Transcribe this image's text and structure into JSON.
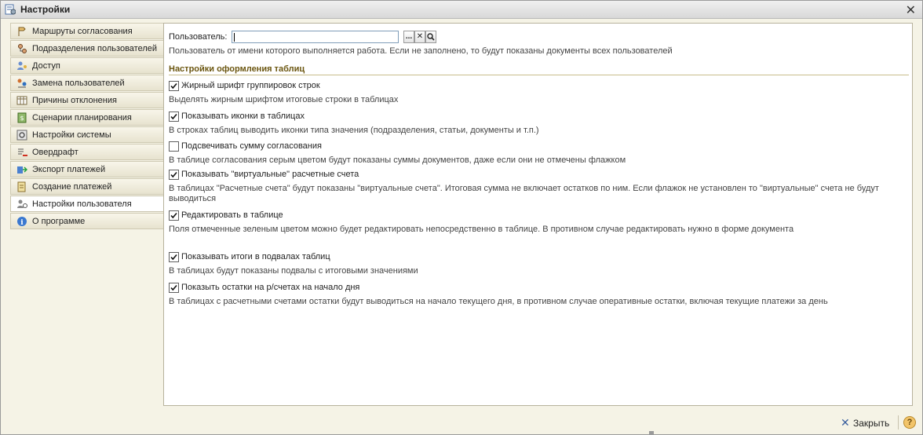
{
  "window": {
    "title": "Настройки",
    "close_glyph": "✕"
  },
  "sidebar": {
    "items": [
      {
        "label": "Маршруты согласования",
        "icon": "route-icon"
      },
      {
        "label": "Подразделения пользователей",
        "icon": "org-tree-icon"
      },
      {
        "label": "Доступ",
        "icon": "users-key-icon"
      },
      {
        "label": "Замена пользователей",
        "icon": "swap-users-icon"
      },
      {
        "label": "Причины отклонения",
        "icon": "table-icon"
      },
      {
        "label": "Сценарии планирования",
        "icon": "scenario-icon"
      },
      {
        "label": "Настройки системы",
        "icon": "settings-icon"
      },
      {
        "label": "Овердрафт",
        "icon": "overdraft-icon"
      },
      {
        "label": "Экспорт платежей",
        "icon": "export-icon"
      },
      {
        "label": "Создание платежей",
        "icon": "create-doc-icon"
      },
      {
        "label": "Настройки пользователя",
        "icon": "user-settings-icon"
      },
      {
        "label": "О программе",
        "icon": "info-icon"
      }
    ],
    "active_index": 10
  },
  "user": {
    "label": "Пользователь:",
    "value": "",
    "select_button": "...",
    "clear_button": "✕",
    "hint": "Пользователь от имени которого выполняется работа. Если не заполнено, то будут показаны документы всех пользователей"
  },
  "section": {
    "title": "Настройки оформления таблиц"
  },
  "options": [
    {
      "label": "Жирный шрифт группировок строк",
      "checked": true,
      "desc": "Выделять жирным шрифтом итоговые строки в таблицах"
    },
    {
      "label": "Показывать иконки в таблицах",
      "checked": true,
      "desc": "В строках таблиц выводить иконки типа значения (подразделения, статьи, документы и т.п.)"
    },
    {
      "label": "Подсвечивать сумму согласования",
      "checked": false,
      "desc": "В таблице согласования серым цветом будут показаны суммы документов, даже если они не отмечены флажком"
    },
    {
      "label": "Показывать \"виртуальные\" расчетные счета",
      "checked": true,
      "desc": "В таблицах \"Расчетные счета\" будут показаны \"виртуальные счета\". Итоговая сумма не включает остатков по ним. Если флажок не установлен то \"виртуальные\" счета не будут выводиться"
    },
    {
      "label": "Редактировать в таблице",
      "checked": true,
      "desc": "Поля отмеченные зеленым цветом можно будет редактировать непосредственно в таблице. В противном случае редактировать нужно в форме документа"
    },
    {
      "label": "Показывать итоги в подвалах таблиц",
      "checked": true,
      "desc": "В таблицах будут показаны подвалы с итоговыми значениями"
    },
    {
      "label": "Показыть остатки на р/счетах на начало дня",
      "checked": true,
      "desc": "В таблицах с расчетными счетами остатки будут выводиться на начало текущего дня, в противном случае оперативные остатки, включая текущие платежи за день"
    }
  ],
  "footer": {
    "close_label": "Закрыть",
    "help_glyph": "?"
  },
  "colors": {
    "accent": "#6b5610",
    "panel": "#f5f3e6"
  }
}
